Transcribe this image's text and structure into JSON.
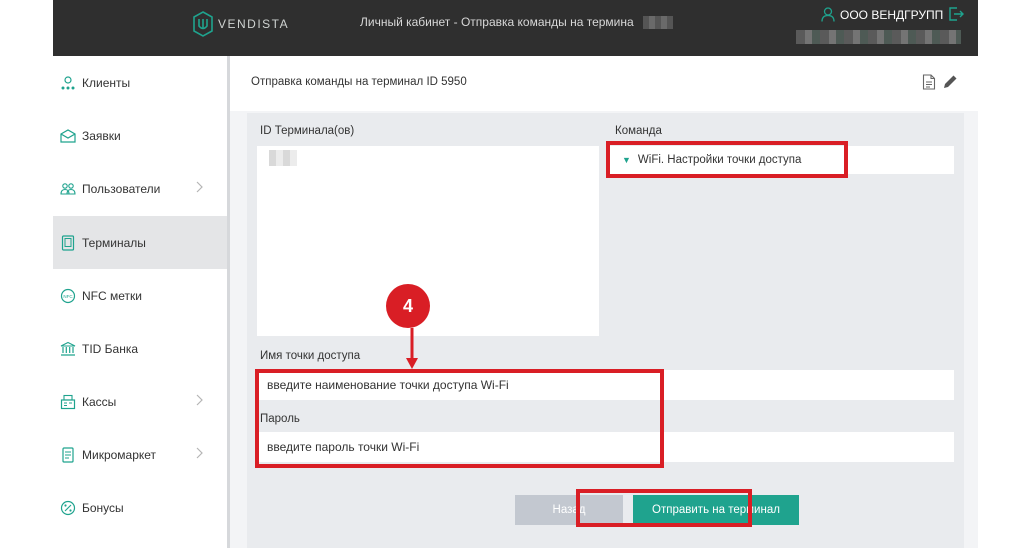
{
  "header": {
    "logo_text": "VENDISTA",
    "title": "Личный кабинет - Отправка команды на термина",
    "user_name": "ООО ВЕНДГРУПП",
    "user_icon": "user-icon",
    "logout_icon": "logout-icon"
  },
  "sidebar": {
    "items": [
      {
        "label": "Клиенты",
        "icon": "clients-icon"
      },
      {
        "label": "Заявки",
        "icon": "mail-icon"
      },
      {
        "label": "Пользователи",
        "icon": "users-icon"
      },
      {
        "label": "Терминалы",
        "icon": "terminal-icon"
      },
      {
        "label": "NFC метки",
        "icon": "nfc-icon"
      },
      {
        "label": "TID Банка",
        "icon": "bank-icon"
      },
      {
        "label": "Кассы",
        "icon": "cashbox-icon"
      },
      {
        "label": "Микромаркет",
        "icon": "micromarket-icon"
      },
      {
        "label": "Бонусы",
        "icon": "bonus-icon"
      }
    ],
    "active": "Терминалы"
  },
  "page": {
    "title": "Отправка команды на терминал ID 5950",
    "icons": [
      "document-icon",
      "pencil-icon"
    ]
  },
  "form": {
    "terminal_ids_label": "ID Терминала(ов)",
    "command_label": "Команда",
    "command_value": "WiFi. Настройки точки доступа",
    "ssid_label": "Имя точки доступа",
    "ssid_placeholder": "введите наименование точки  доступа  Wi-Fi",
    "password_label": "Пароль",
    "password_placeholder": "введите пароль точки Wi-Fi",
    "back_button": "Назад",
    "send_button": "Отправить на терминал"
  },
  "annotation": {
    "step_number": "4"
  },
  "colors": {
    "header_bg": "#2f2f2f",
    "accent": "#1fa38e",
    "highlight": "#d91e25",
    "back_button": "#c3c8d0"
  }
}
